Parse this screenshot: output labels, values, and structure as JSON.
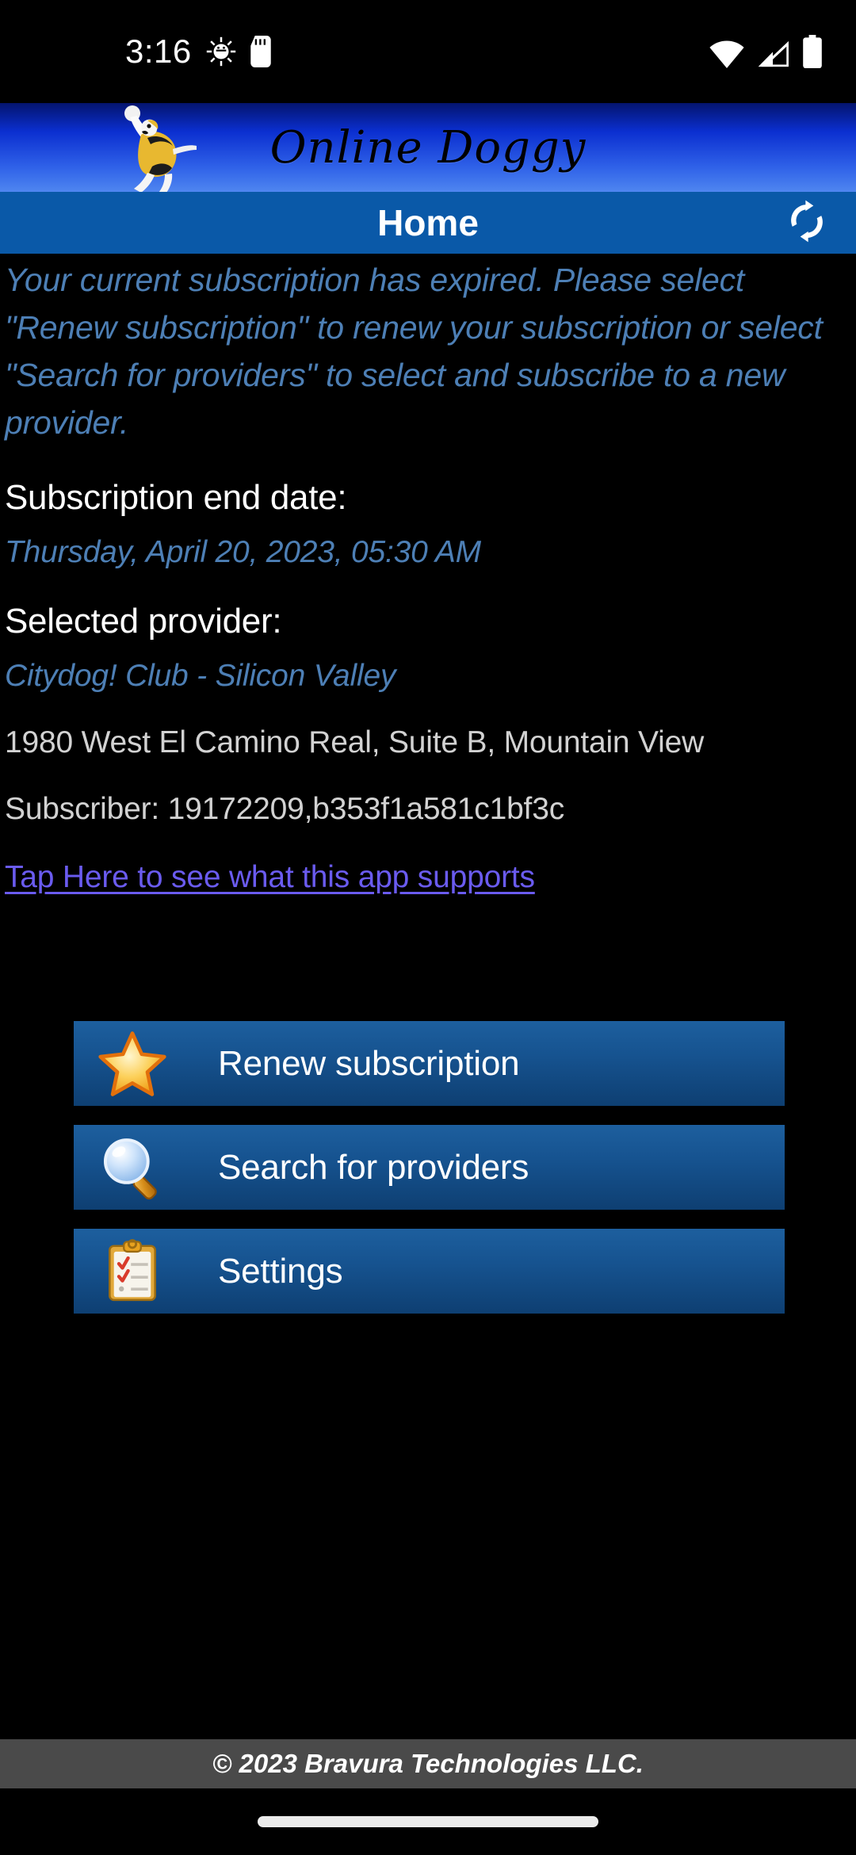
{
  "status_bar": {
    "time": "3:16",
    "icons": [
      "bug-debug-icon",
      "sd-card-icon",
      "wifi-icon",
      "cellular-signal-icon",
      "battery-icon"
    ]
  },
  "banner": {
    "app_title": "Online Doggy",
    "logo_icon": "jumping-dog-logo"
  },
  "action_bar": {
    "title": "Home",
    "refresh_icon": "refresh-icon"
  },
  "main": {
    "notice": "Your current subscription has expired. Please select \"Renew subscription\" to renew your subscription or select \"Search for providers\" to select and subscribe to a new provider.",
    "end_date_label": "Subscription end date:",
    "end_date_value": "Thursday, April 20, 2023, 05:30 AM",
    "provider_label": "Selected provider:",
    "provider_value": "Citydog! Club - Silicon Valley",
    "provider_address": "1980 West El Camino Real, Suite B, Mountain View",
    "subscriber_line": "Subscriber: 19172209,b353f1a581c1bf3c",
    "support_link": "Tap Here to see what this app supports"
  },
  "buttons": [
    {
      "label": "Renew subscription",
      "icon": "star-icon"
    },
    {
      "label": "Search for providers",
      "icon": "magnifier-icon"
    },
    {
      "label": "Settings",
      "icon": "clipboard-checklist-icon"
    }
  ],
  "footer": {
    "copyright": "© 2023 Bravura Technologies LLC."
  },
  "colors": {
    "background": "#000000",
    "action_bar": "#0a59a8",
    "banner_blue": "#0b2fd0",
    "accent_text": "#4d7fb5",
    "link": "#6a5bef",
    "button_blue": "#165390",
    "footer_gray": "#4a4a4a"
  }
}
